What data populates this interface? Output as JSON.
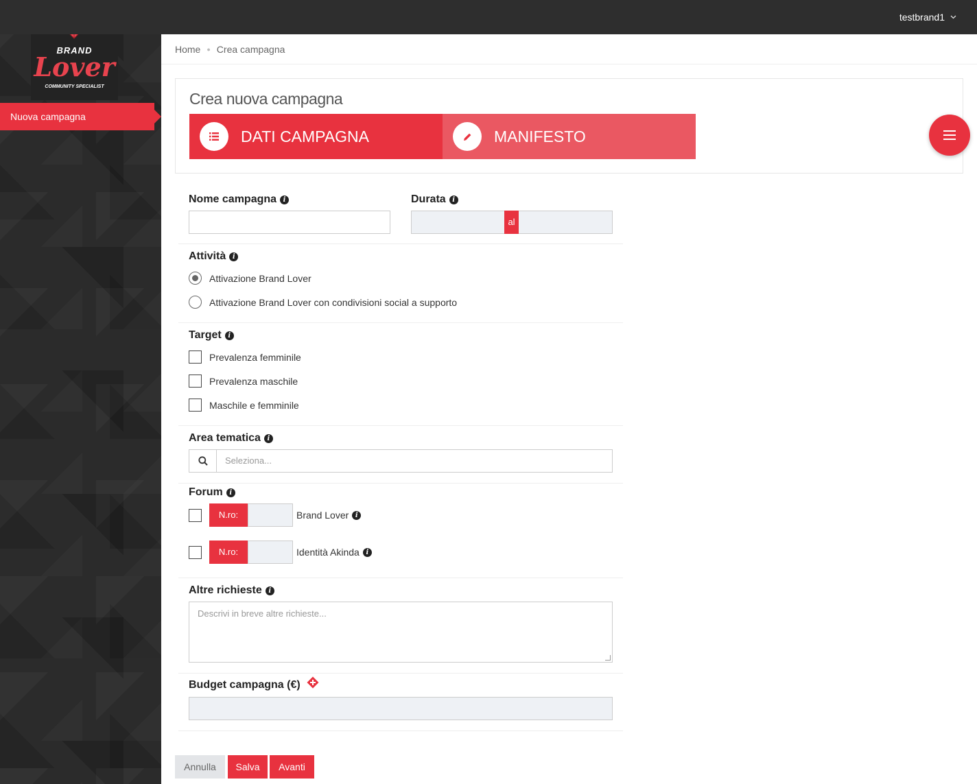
{
  "topbar": {
    "username": "testbrand1"
  },
  "logo": {
    "brand": "BRAND",
    "lover": "Lover",
    "tagline": "COMMUNITY SPECIALIST"
  },
  "sidebar": {
    "items": [
      {
        "label": "Nuova campagna"
      }
    ]
  },
  "breadcrumb": {
    "home": "Home",
    "current": "Crea campagna"
  },
  "header": {
    "title": "Crea nuova campagna",
    "steps": [
      {
        "label": "DATI CAMPAGNA"
      },
      {
        "label": "MANIFESTO"
      }
    ]
  },
  "form": {
    "nome_campagna": {
      "label": "Nome campagna",
      "value": ""
    },
    "durata": {
      "label": "Durata",
      "separator": "al"
    },
    "attivita": {
      "label": "Attività",
      "options": [
        {
          "label": "Attivazione Brand Lover",
          "selected": true
        },
        {
          "label": "Attivazione Brand Lover con condivisioni social a supporto",
          "selected": false
        }
      ]
    },
    "target": {
      "label": "Target",
      "options": [
        {
          "label": "Prevalenza femminile",
          "checked": false
        },
        {
          "label": "Prevalenza maschile",
          "checked": false
        },
        {
          "label": "Maschile e femminile",
          "checked": false
        }
      ]
    },
    "area_tematica": {
      "label": "Area tematica",
      "placeholder": "Seleziona..."
    },
    "forum": {
      "label": "Forum",
      "rows": [
        {
          "prefix": "N.ro:",
          "name": "Brand Lover"
        },
        {
          "prefix": "N.ro:",
          "name": "Identità Akinda"
        }
      ]
    },
    "altre_richieste": {
      "label": "Altre richieste",
      "placeholder": "Descrivi in breve altre richieste..."
    },
    "budget": {
      "label": "Budget campagna (€)"
    }
  },
  "actions": {
    "cancel": "Annulla",
    "save": "Salva",
    "next": "Avanti"
  },
  "colors": {
    "accent": "#e8323f",
    "accent_light": "#ea5862",
    "topbar": "#2e2e2e",
    "sidebar": "#2b2b2b"
  }
}
